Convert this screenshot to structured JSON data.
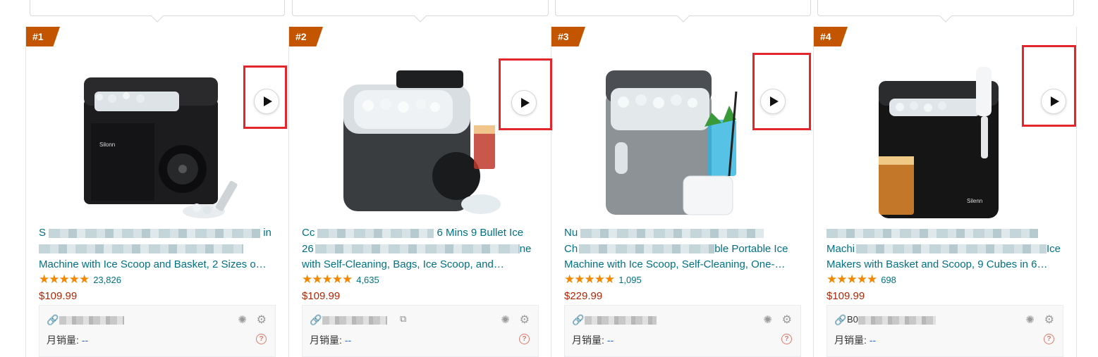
{
  "products": [
    {
      "rank": "#1",
      "title_lines": [
        "S",
        "",
        "Machine with Ice Scoop and Basket, 2 Sizes o…"
      ],
      "title_tail": "in",
      "rating_stars": 4.5,
      "reviews": "23,826",
      "price": "$109.99",
      "asin_prefix": "",
      "sales_label": "月销量:",
      "sales_value": "--"
    },
    {
      "rank": "#2",
      "title_lines": [
        "Cc",
        "26",
        "with Self-Cleaning, Bags, Ice Scoop, and…"
      ],
      "title_tail": "6 Mins 9 Bullet Ice",
      "rating_stars": 4.5,
      "reviews": "4,635",
      "price": "$109.99",
      "asin_prefix": "",
      "sales_label": "月销量:",
      "sales_value": "--"
    },
    {
      "rank": "#3",
      "title_lines": [
        "Nu",
        "Ch",
        "Machine with Ice Scoop, Self-Cleaning, One-…"
      ],
      "title_tail": "ble Portable Ice",
      "rating_stars": 4.5,
      "reviews": "1,095",
      "price": "$229.99",
      "asin_prefix": "",
      "sales_label": "月销量:",
      "sales_value": "--"
    },
    {
      "rank": "#4",
      "title_lines": [
        "",
        "Machi",
        "Makers with Basket and Scoop, 9 Cubes in 6…"
      ],
      "title_tail": "Ice",
      "rating_stars": 4.5,
      "reviews": "698",
      "price": "$109.99",
      "asin_prefix": "B0",
      "sales_label": "月销量:",
      "sales_value": "--"
    }
  ],
  "colors": {
    "rank_bg": "#c45500",
    "link": "#007185",
    "price": "#b12704",
    "highlight": "#e3262c"
  },
  "icons": [
    "play-icon",
    "link-icon",
    "copy-icon",
    "loading-spinner-icon",
    "gear-icon",
    "help-icon",
    "star-icon"
  ]
}
